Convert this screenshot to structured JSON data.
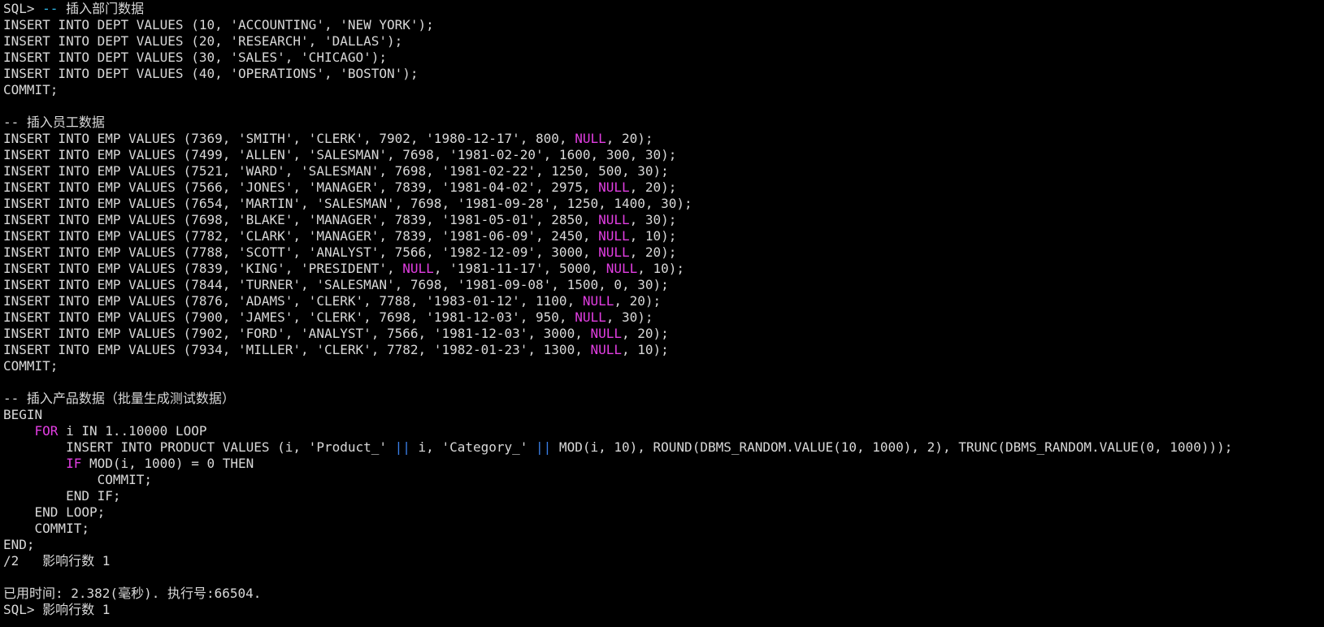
{
  "colors": {
    "background": "#000000",
    "text": "#d8d8d8",
    "keyword": "#e23ee2",
    "comment": "#2fb8e8",
    "operator": "#3a7fe8"
  },
  "lines": [
    [
      [
        "SQL> ",
        ""
      ],
      [
        "--",
        "cm"
      ],
      [
        " 插入部门数据",
        ""
      ]
    ],
    [
      [
        "INSERT INTO DEPT VALUES (10, 'ACCOUNTING', 'NEW YORK');",
        ""
      ]
    ],
    [
      [
        "INSERT INTO DEPT VALUES (20, 'RESEARCH', 'DALLAS');",
        ""
      ]
    ],
    [
      [
        "INSERT INTO DEPT VALUES (30, 'SALES', 'CHICAGO');",
        ""
      ]
    ],
    [
      [
        "INSERT INTO DEPT VALUES (40, 'OPERATIONS', 'BOSTON');",
        ""
      ]
    ],
    [
      [
        "COMMIT;",
        ""
      ]
    ],
    [
      [
        "",
        ""
      ]
    ],
    [
      [
        "-- 插入员工数据",
        ""
      ]
    ],
    [
      [
        "INSERT INTO EMP VALUES (7369, 'SMITH', 'CLERK', 7902, '1980-12-17', 800, ",
        ""
      ],
      [
        "NULL",
        "kw"
      ],
      [
        ", 20);",
        ""
      ]
    ],
    [
      [
        "INSERT INTO EMP VALUES (7499, 'ALLEN', 'SALESMAN', 7698, '1981-02-20', 1600, 300, 30);",
        ""
      ]
    ],
    [
      [
        "INSERT INTO EMP VALUES (7521, 'WARD', 'SALESMAN', 7698, '1981-02-22', 1250, 500, 30);",
        ""
      ]
    ],
    [
      [
        "INSERT INTO EMP VALUES (7566, 'JONES', 'MANAGER', 7839, '1981-04-02', 2975, ",
        ""
      ],
      [
        "NULL",
        "kw"
      ],
      [
        ", 20);",
        ""
      ]
    ],
    [
      [
        "INSERT INTO EMP VALUES (7654, 'MARTIN', 'SALESMAN', 7698, '1981-09-28', 1250, 1400, 30);",
        ""
      ]
    ],
    [
      [
        "INSERT INTO EMP VALUES (7698, 'BLAKE', 'MANAGER', 7839, '1981-05-01', 2850, ",
        ""
      ],
      [
        "NULL",
        "kw"
      ],
      [
        ", 30);",
        ""
      ]
    ],
    [
      [
        "INSERT INTO EMP VALUES (7782, 'CLARK', 'MANAGER', 7839, '1981-06-09', 2450, ",
        ""
      ],
      [
        "NULL",
        "kw"
      ],
      [
        ", 10);",
        ""
      ]
    ],
    [
      [
        "INSERT INTO EMP VALUES (7788, 'SCOTT', 'ANALYST', 7566, '1982-12-09', 3000, ",
        ""
      ],
      [
        "NULL",
        "kw"
      ],
      [
        ", 20);",
        ""
      ]
    ],
    [
      [
        "INSERT INTO EMP VALUES (7839, 'KING', 'PRESIDENT', ",
        ""
      ],
      [
        "NULL",
        "kw"
      ],
      [
        ", '1981-11-17', 5000, ",
        ""
      ],
      [
        "NULL",
        "kw"
      ],
      [
        ", 10);",
        ""
      ]
    ],
    [
      [
        "INSERT INTO EMP VALUES (7844, 'TURNER', 'SALESMAN', 7698, '1981-09-08', 1500, 0, 30);",
        ""
      ]
    ],
    [
      [
        "INSERT INTO EMP VALUES (7876, 'ADAMS', 'CLERK', 7788, '1983-01-12', 1100, ",
        ""
      ],
      [
        "NULL",
        "kw"
      ],
      [
        ", 20);",
        ""
      ]
    ],
    [
      [
        "INSERT INTO EMP VALUES (7900, 'JAMES', 'CLERK', 7698, '1981-12-03', 950, ",
        ""
      ],
      [
        "NULL",
        "kw"
      ],
      [
        ", 30);",
        ""
      ]
    ],
    [
      [
        "INSERT INTO EMP VALUES (7902, 'FORD', 'ANALYST', 7566, '1981-12-03', 3000, ",
        ""
      ],
      [
        "NULL",
        "kw"
      ],
      [
        ", 20);",
        ""
      ]
    ],
    [
      [
        "INSERT INTO EMP VALUES (7934, 'MILLER', 'CLERK', 7782, '1982-01-23', 1300, ",
        ""
      ],
      [
        "NULL",
        "kw"
      ],
      [
        ", 10);",
        ""
      ]
    ],
    [
      [
        "COMMIT;",
        ""
      ]
    ],
    [
      [
        "",
        ""
      ]
    ],
    [
      [
        "-- 插入产品数据（批量生成测试数据）",
        ""
      ]
    ],
    [
      [
        "BEGIN",
        ""
      ]
    ],
    [
      [
        "    ",
        ""
      ],
      [
        "FOR",
        "kw"
      ],
      [
        " i IN 1..10000 LOOP",
        ""
      ]
    ],
    [
      [
        "        INSERT INTO PRODUCT VALUES (i, 'Product_' ",
        ""
      ],
      [
        "||",
        "op"
      ],
      [
        " i, 'Category_' ",
        ""
      ],
      [
        "||",
        "op"
      ],
      [
        " MOD(i, 10), ROUND(DBMS_RANDOM.VALUE(10, 1000), 2), TRUNC(DBMS_RANDOM.VALUE(0, 1000)));",
        ""
      ]
    ],
    [
      [
        "        ",
        ""
      ],
      [
        "IF",
        "kw"
      ],
      [
        " MOD(i, 1000) = 0 THEN",
        ""
      ]
    ],
    [
      [
        "            COMMIT;",
        ""
      ]
    ],
    [
      [
        "        END IF;",
        ""
      ]
    ],
    [
      [
        "    END LOOP;",
        ""
      ]
    ],
    [
      [
        "    COMMIT;",
        ""
      ]
    ],
    [
      [
        "END;",
        ""
      ]
    ],
    [
      [
        "/2   影响行数 1",
        ""
      ]
    ],
    [
      [
        "",
        ""
      ]
    ],
    [
      [
        "已用时间: 2.382(毫秒). 执行号:66504.",
        ""
      ]
    ],
    [
      [
        "SQL> 影响行数 1",
        ""
      ]
    ]
  ]
}
